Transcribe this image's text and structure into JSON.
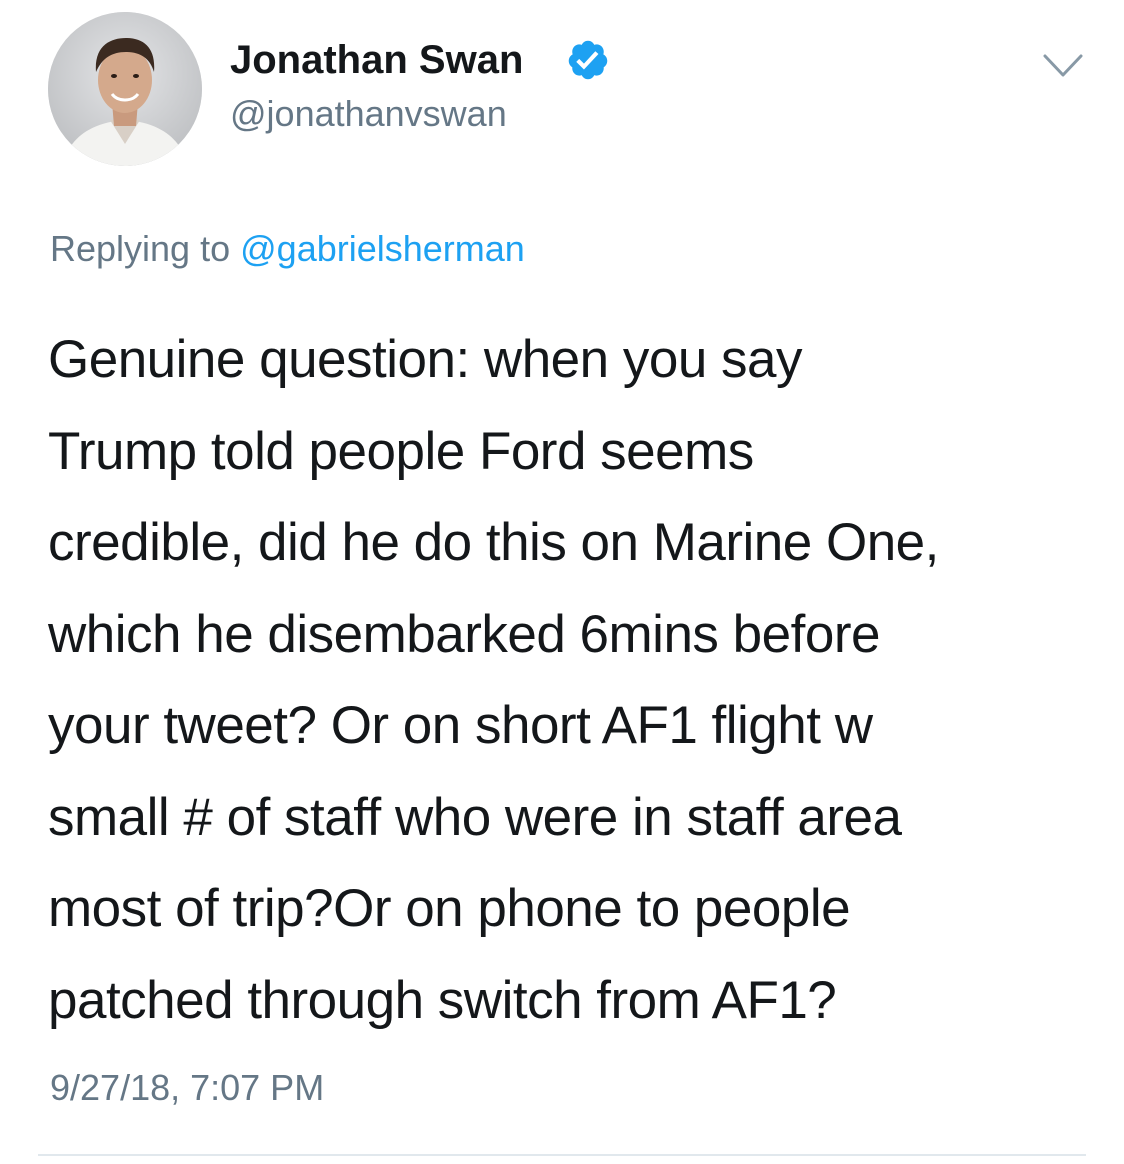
{
  "tweet": {
    "author": {
      "display_name": "Jonathan Swan",
      "handle": "@jonathanvswan",
      "verified": true,
      "avatar_icon": "profile-photo"
    },
    "menu_icon": "chevron-down-icon",
    "reply_context": {
      "prefix": "Replying to",
      "mention": "@gabrielsherman"
    },
    "text_lines": [
      "Genuine question: when you say",
      "Trump told people Ford seems",
      "credible, did he do this on Marine One,",
      "which he disembarked 6mins before",
      "your tweet? Or on short AF1 flight w",
      "small # of staff who were in staff area",
      "most of trip?Or on phone to people",
      "patched through switch from AF1?"
    ],
    "timestamp": "9/27/18, 7:07 PM"
  },
  "colors": {
    "text": "#14171a",
    "secondary": "#657786",
    "link": "#1da1f2",
    "verified_badge": "#1da1f2",
    "divider": "#e1e8ed"
  }
}
